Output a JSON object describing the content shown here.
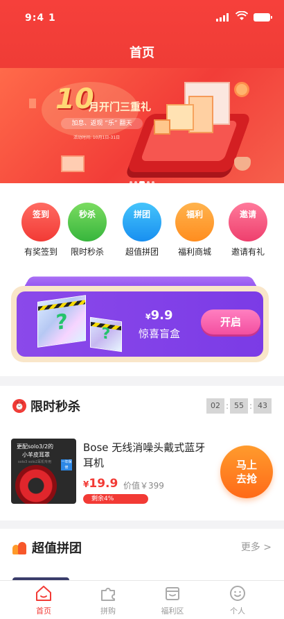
{
  "status_bar": {
    "time": "9:4 1"
  },
  "header": {
    "title": "首页"
  },
  "banner": {
    "big_number": "10",
    "headline": "月开门三重礼",
    "pill": "加息、返现 “乐” 翻天",
    "small_text": "活动时间: 10月1日-31日",
    "dots": 5,
    "active_dot": 2
  },
  "nav": {
    "items": [
      {
        "tag": "签到",
        "label": "有奖签到",
        "color": "#f23a35"
      },
      {
        "tag": "秒杀",
        "label": "限时秒杀",
        "color": "#37b53c"
      },
      {
        "tag": "拼团",
        "label": "超值拼团",
        "color": "#188ff0"
      },
      {
        "tag": "福利",
        "label": "福利商城",
        "color": "#ff8d1f"
      },
      {
        "tag": "邀请",
        "label": "邀请有礼",
        "color": "#ee3f6d"
      }
    ]
  },
  "blind_box": {
    "currency": "¥",
    "price": "9.9",
    "name": "惊喜盲盒",
    "button": "开启",
    "question_mark": "?"
  },
  "flash_sale": {
    "title": "限时秒杀",
    "alarm_glyph": "⏰",
    "timer": {
      "hours": "02",
      "minutes": "55",
      "seconds": "43",
      "separator": ":"
    },
    "product": {
      "name": "Bose 无线消噪头戴式蓝牙耳机",
      "image_line1": "更配solo3/2的",
      "image_line2": "小羊皮耳罩",
      "image_line3": "solo3 solo2耳机专用",
      "image_badge": "一年保修",
      "currency": "¥",
      "price": "19.9",
      "original_price": "价值￥399",
      "remaining": "剩余4%",
      "remaining_fraction": 0.04,
      "button_line1": "马上",
      "button_line2": "去抢"
    }
  },
  "group_buy": {
    "title": "超值拼团",
    "more": "更多 >"
  },
  "tabbar": {
    "tabs": [
      {
        "label": "首页",
        "icon": "home-icon",
        "active": true
      },
      {
        "label": "拼购",
        "icon": "puzzle-icon",
        "active": false
      },
      {
        "label": "福利区",
        "icon": "gift-box-icon",
        "active": false
      },
      {
        "label": "个人",
        "icon": "smiley-icon",
        "active": false
      }
    ],
    "active_color": "#f23a35",
    "inactive_color": "#999999"
  }
}
